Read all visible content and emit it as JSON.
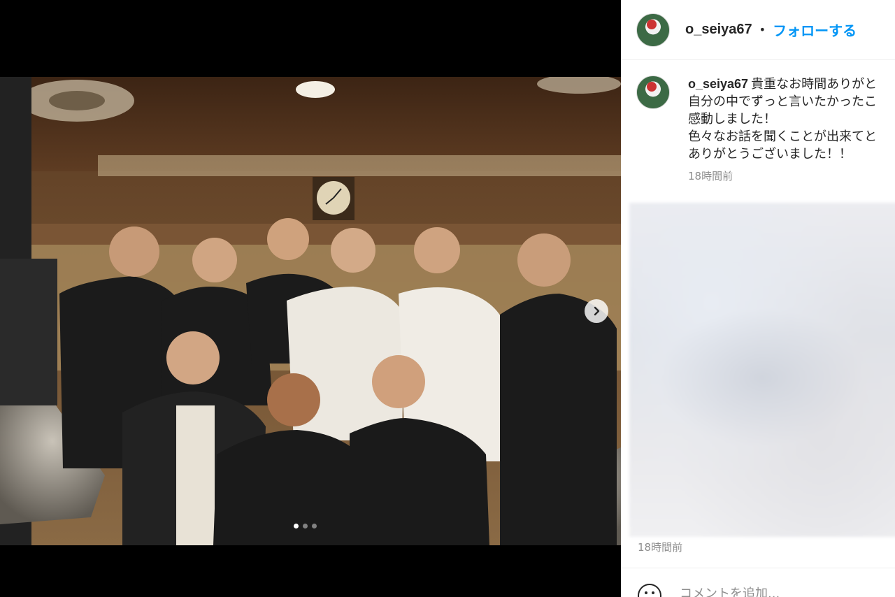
{
  "post": {
    "username": "o_seiya67",
    "separator": "•",
    "follow_label": "フォローする"
  },
  "caption": {
    "username": "o_seiya67",
    "lines": [
      "貴重なお時間ありがと",
      "自分の中でずっと言いたかったこ",
      "感動しました！",
      "色々なお話を聞くことが出来てと",
      "ありがとうございました！！"
    ],
    "time": "18時間前"
  },
  "media": {
    "slide_count": 3,
    "active_slide": 1
  },
  "footer": {
    "time": "18時間前",
    "comment_placeholder": "コメントを追加..."
  },
  "icons": {
    "next": "chevron-right-icon",
    "emoji": "emoji-icon"
  },
  "colors": {
    "link_blue": "#0095f6",
    "text": "#262626",
    "muted": "#8e8e8e"
  }
}
